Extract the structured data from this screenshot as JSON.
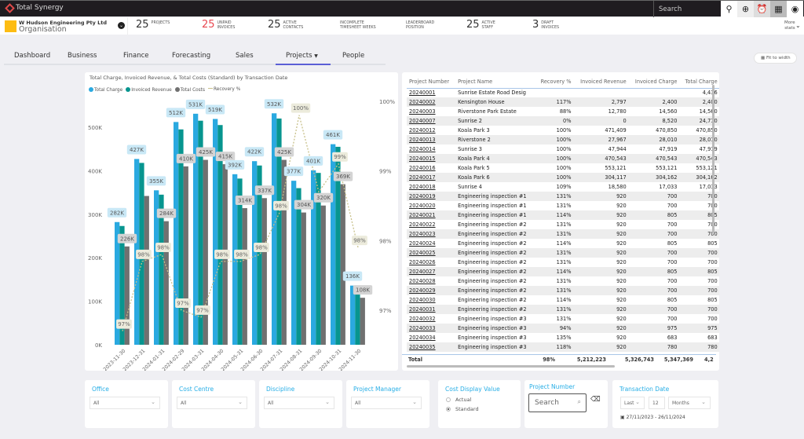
{
  "app": {
    "brand": "Total Synergy",
    "search_placeholder": "Search"
  },
  "topbar_icons": [
    "location-pin-icon",
    "add-circle-icon",
    "alarm-clock-icon",
    "calendar-icon",
    "user-account-icon"
  ],
  "org": {
    "name": "W Hudson Engineering Pty Ltd",
    "type": "Organisation"
  },
  "stats": [
    {
      "value": "25",
      "label1": "Projects",
      "label2": "",
      "alert": false
    },
    {
      "value": "25",
      "label1": "Unpaid",
      "label2": "Invoices",
      "alert": true
    },
    {
      "value": "25",
      "label1": "Active",
      "label2": "Contacts",
      "alert": false
    },
    {
      "value": "",
      "label1": "Incomplete",
      "label2": "Timesheet Weeks",
      "alert": false
    },
    {
      "value": "",
      "label1": "Leaderboard",
      "label2": "Position",
      "alert": false
    },
    {
      "value": "25",
      "label1": "Active",
      "label2": "Staff",
      "alert": false
    },
    {
      "value": "3",
      "label1": "Draft",
      "label2": "Invoices",
      "alert": false
    }
  ],
  "more_stats": {
    "line1": "More",
    "line2": "stats"
  },
  "tabs": [
    "Dashboard",
    "Business",
    "Finance",
    "Forecasting",
    "Sales",
    "Projects",
    "People"
  ],
  "active_tab": "Projects",
  "fit_to_width": "Fit to width",
  "colors": {
    "total_charge": "#2aa9e0",
    "invoiced_revenue": "#07958f",
    "total_costs": "#707070",
    "recovery": "#c8c08a",
    "accent": "#5b5fd6",
    "filter_label": "#27aee6"
  },
  "chart_data": {
    "type": "bar",
    "title": "Total Charge, Invoiced Revenue, & Total Costs (Standard) by Transaction Date",
    "categories": [
      "2023-11-30",
      "2023-12-31",
      "2024-01-31",
      "2024-02-29",
      "2024-03-31",
      "2024-04-30",
      "2024-05-31",
      "2024-06-30",
      "2024-07-31",
      "2024-08-31",
      "2024-09-30",
      "2024-10-31",
      "2024-11-30"
    ],
    "series": [
      {
        "name": "Total Charge",
        "values": [
          282,
          427,
          355,
          512,
          531,
          519,
          392,
          422,
          532,
          377,
          401,
          461,
          136
        ],
        "labels": [
          "282K",
          "427K",
          "355K",
          "512K",
          "531K",
          "519K",
          "392K",
          "422K",
          "532K",
          "377K",
          "401K",
          "461K",
          "136K"
        ]
      },
      {
        "name": "Invoiced Revenue",
        "values": [
          273,
          418,
          345,
          495,
          515,
          505,
          382,
          412,
          520,
          360,
          395,
          455,
          133
        ]
      },
      {
        "name": "Total Costs",
        "values": [
          226,
          342,
          284,
          410,
          425,
          415,
          314,
          337,
          425,
          304,
          320,
          369,
          108
        ],
        "labels": [
          "226K",
          "",
          "284K",
          "410K",
          "425K",
          "415K",
          "314K",
          "337K",
          "425K",
          "304K",
          "320K",
          "369K",
          "108K"
        ]
      },
      {
        "name": "Recovery %",
        "axis": "right",
        "values": [
          96.7,
          97.7,
          97.8,
          97.0,
          96.9,
          97.7,
          97.7,
          97.8,
          98.4,
          99.8,
          98.7,
          99.1,
          97.9
        ],
        "labels": [
          "97%",
          "98%",
          "98%",
          "97%",
          "97%",
          "98%",
          "98%",
          "98%",
          "98%",
          "100%",
          "",
          "99%",
          "98%"
        ]
      }
    ],
    "y_left": {
      "ticks": [
        "0K",
        "100K",
        "200K",
        "300K",
        "400K",
        "500K"
      ],
      "range": [
        0,
        580
      ]
    },
    "y_right": {
      "ticks": [
        "97%",
        "98%",
        "99%",
        "100%"
      ],
      "range": [
        96.5,
        100
      ]
    },
    "legend": "top-left",
    "grid": false
  },
  "table": {
    "columns": [
      "Project Number",
      "Project Name",
      "Recovery %",
      "Invoiced Revenue",
      "Invoiced Charge",
      "Total Charge",
      "Tota"
    ],
    "rows": [
      [
        "20240001",
        "Sunrise Estate Road Desig",
        "",
        "",
        "",
        "4,436"
      ],
      [
        "20240002",
        "Kensington House",
        "117%",
        "2,797",
        "2,400",
        "2,400"
      ],
      [
        "20240003",
        "Riverstone Park Estate",
        "88%",
        "12,780",
        "14,560",
        "14,560"
      ],
      [
        "20240007",
        "Sunrise 2",
        "0%",
        "0",
        "8,520",
        "24,710"
      ],
      [
        "20240012",
        "Koala Park 3",
        "100%",
        "471,409",
        "470,850",
        "470,850"
      ],
      [
        "20240013",
        "Riverstone 2",
        "100%",
        "27,967",
        "28,010",
        "28,010"
      ],
      [
        "20240014",
        "Sunrise 3",
        "100%",
        "47,944",
        "47,919",
        "47,919"
      ],
      [
        "20240015",
        "Koala Park 4",
        "100%",
        "470,543",
        "470,543",
        "470,543"
      ],
      [
        "20240016",
        "Koala Park 5",
        "100%",
        "553,121",
        "553,121",
        "553,121"
      ],
      [
        "20240017",
        "Koala Park 6",
        "100%",
        "304,117",
        "304,162",
        "304,162"
      ],
      [
        "20240018",
        "Sunrise 4",
        "109%",
        "18,580",
        "17,033",
        "17,033"
      ],
      [
        "20240019",
        "Engineering inspection #1",
        "131%",
        "920",
        "700",
        "700"
      ],
      [
        "20240020",
        "Engineering inspection #1",
        "131%",
        "920",
        "700",
        "700"
      ],
      [
        "20240021",
        "Engineering inspection #1",
        "114%",
        "920",
        "805",
        "805"
      ],
      [
        "20240022",
        "Engineering inspection #2",
        "131%",
        "920",
        "700",
        "700"
      ],
      [
        "20240023",
        "Engineering inspection #2",
        "131%",
        "920",
        "700",
        "700"
      ],
      [
        "20240024",
        "Engineering inspection #2",
        "114%",
        "920",
        "805",
        "805"
      ],
      [
        "20240025",
        "Engineering inspection #2",
        "131%",
        "920",
        "700",
        "700"
      ],
      [
        "20240026",
        "Engineering inspection #2",
        "131%",
        "920",
        "700",
        "700"
      ],
      [
        "20240027",
        "Engineering inspection #2",
        "114%",
        "920",
        "805",
        "805"
      ],
      [
        "20240028",
        "Engineering inspection #2",
        "131%",
        "920",
        "700",
        "700"
      ],
      [
        "20240029",
        "Engineering inspection #2",
        "131%",
        "920",
        "700",
        "700"
      ],
      [
        "20240030",
        "Engineering inspection #2",
        "114%",
        "920",
        "805",
        "805"
      ],
      [
        "20240031",
        "Engineering inspection #2",
        "131%",
        "920",
        "700",
        "700"
      ],
      [
        "20240032",
        "Engineering inspection #3",
        "131%",
        "920",
        "700",
        "700"
      ],
      [
        "20240033",
        "Engineering inspection #3",
        "94%",
        "920",
        "975",
        "975"
      ],
      [
        "20240034",
        "Engineering inspection #3",
        "135%",
        "920",
        "683",
        "683"
      ],
      [
        "20240035",
        "Engineering inspection #3",
        "118%",
        "920",
        "780",
        "780"
      ]
    ],
    "total": {
      "label": "Total",
      "recovery": "98%",
      "invoiced_revenue": "5,212,223",
      "invoiced_charge": "5,326,743",
      "total_charge": "5,347,369",
      "cut": "4,2"
    }
  },
  "filters": {
    "office": {
      "label": "Office",
      "value": "All"
    },
    "cost_centre": {
      "label": "Cost Centre",
      "value": "All"
    },
    "discipline": {
      "label": "Discipline",
      "value": "All"
    },
    "project_manager": {
      "label": "Project Manager",
      "value": "All"
    },
    "cost_display": {
      "label": "Cost Display Value",
      "options": [
        "Actual",
        "Standard"
      ],
      "selected": "Standard"
    },
    "project_number": {
      "label": "Project Number",
      "placeholder": "Search"
    },
    "transaction_date": {
      "label": "Transaction Date",
      "period": "Last",
      "count": "12",
      "unit": "Months",
      "range": "27/11/2023 - 26/11/2024"
    }
  }
}
